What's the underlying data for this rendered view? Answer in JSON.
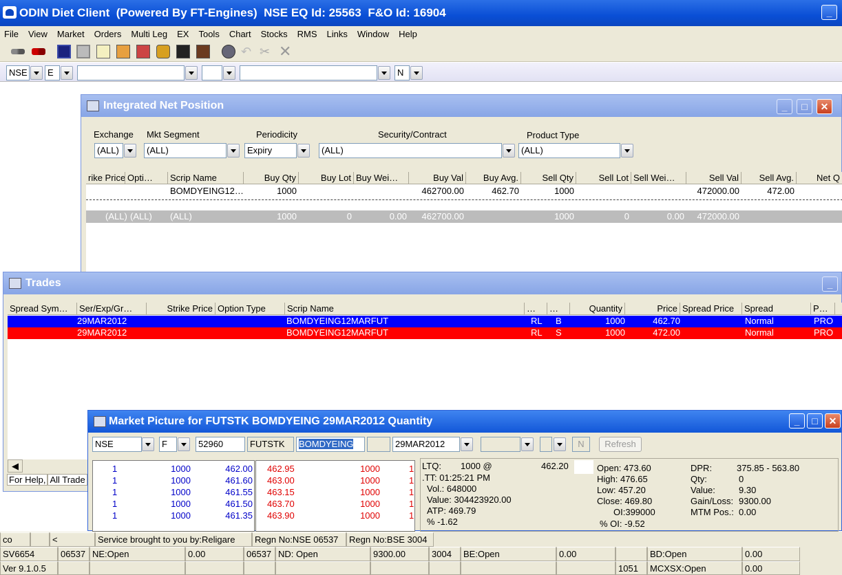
{
  "app": {
    "title": "ODIN Diet Client  (Powered By FT-Engines)  NSE EQ Id: 25563  F&O Id: 16904"
  },
  "menu": [
    "File",
    "View",
    "Market",
    "Orders",
    "Multi Leg",
    "EX",
    "Tools",
    "Chart",
    "Stocks",
    "RMS",
    "Links",
    "Window",
    "Help"
  ],
  "toolbar_icons": [
    "connect-icon",
    "disconnect-icon",
    "save-icon",
    "print-icon",
    "edit-icon",
    "watch-icon",
    "book-icon",
    "package-icon",
    "chart-icon",
    "binoculars-icon",
    "gear-icon",
    "undo-icon",
    "scissors-icon",
    "close-icon"
  ],
  "filterbar": {
    "exchange": "NSE",
    "segment": "E",
    "series": "N"
  },
  "net_position": {
    "title": "Integrated Net Position",
    "labels": {
      "exchange": "Exchange",
      "segment": "Mkt Segment",
      "periodicity": "Periodicity",
      "security": "Security/Contract",
      "product": "Product Type"
    },
    "values": {
      "exchange": "(ALL)",
      "segment": "(ALL)",
      "periodicity": "Expiry",
      "security": "(ALL)",
      "product": "(ALL)"
    },
    "columns": [
      "rike Price",
      "Opti…",
      "Scrip Name",
      "Buy Qty",
      "Buy Lot",
      "Buy Wei…",
      "Buy Val",
      "Buy Avg.",
      "Sell Qty",
      "Sell Lot",
      "Sell Wei…",
      "Sell Val",
      "Sell Avg.",
      "Net Q"
    ],
    "row": {
      "scrip": "BOMDYEING12…",
      "buy_qty": "1000",
      "buy_val": "462700.00",
      "buy_avg": "462.70",
      "sell_qty": "1000",
      "sell_val": "472000.00",
      "sell_avg": "472.00"
    },
    "total": {
      "strike": "(ALL)",
      "opt": "(ALL)",
      "scrip": "(ALL)",
      "buy_qty": "1000",
      "buy_lot": "0",
      "buy_wei": "0.00",
      "buy_val": "462700.00",
      "sell_qty": "1000",
      "sell_lot": "0",
      "sell_wei": "0.00",
      "sell_val": "472000.00"
    }
  },
  "trades": {
    "title": "Trades",
    "columns": [
      "Spread Sym…",
      "Ser/Exp/Gr…",
      "Strike Price",
      "Option Type",
      "Scrip Name",
      "…",
      "…",
      "Quantity",
      "Price",
      "Spread Price",
      "Spread",
      "P…"
    ],
    "rows": [
      {
        "exp": "29MAR2012",
        "scrip": "BOMDYEING12MARFUT",
        "d": "RL",
        "bs": "B",
        "qty": "1000",
        "price": "462.70",
        "spread": "Normal",
        "p": "PRO",
        "bg": "#0000ff"
      },
      {
        "exp": "29MAR2012",
        "scrip": "BOMDYEING12MARFUT",
        "d": "RL",
        "bs": "S",
        "qty": "1000",
        "price": "472.00",
        "spread": "Normal",
        "p": "PRO",
        "bg": "#ff0000"
      }
    ],
    "tabs": [
      "For Help,",
      "All Trade"
    ]
  },
  "market_picture": {
    "title": "Market Picture for FUTSTK BOMDYEING 29MAR2012  Quantity",
    "fields": {
      "exchange": "NSE",
      "segment": "F",
      "token": "52960",
      "instrument": "FUTSTK",
      "symbol": "BOMDYEING",
      "expiry": "29MAR2012",
      "n": "N",
      "refresh": "Refresh"
    },
    "bids": [
      {
        "orders": "1",
        "qty": "1000",
        "price": "462.00"
      },
      {
        "orders": "1",
        "qty": "1000",
        "price": "461.60"
      },
      {
        "orders": "1",
        "qty": "1000",
        "price": "461.55"
      },
      {
        "orders": "1",
        "qty": "1000",
        "price": "461.50"
      },
      {
        "orders": "1",
        "qty": "1000",
        "price": "461.35"
      }
    ],
    "asks": [
      {
        "price": "462.95",
        "qty": "1000",
        "orders": "1"
      },
      {
        "price": "463.00",
        "qty": "1000",
        "orders": "1"
      },
      {
        "price": "463.15",
        "qty": "1000",
        "orders": "1"
      },
      {
        "price": "463.70",
        "qty": "1000",
        "orders": "1"
      },
      {
        "price": "463.90",
        "qty": "1000",
        "orders": "1"
      }
    ],
    "stats1": {
      "ltq": "LTQ:",
      "ltq_val": "1000 @",
      "ltp": "462.20",
      "ltt": ".TT:  01:25:21 PM",
      "vol": "Vol.:   648000",
      "value": "Value: 304423920.00",
      "atp": "ATP:   469.79",
      "pct": "%      -1.62"
    },
    "stats2": {
      "open": "Open:  473.60",
      "high": "High:   476.65",
      "low": "Low:    457.20",
      "close": "Close:  469.80",
      "oi": "OI:399000",
      "pctoi": "% OI: -9.52"
    },
    "stats3": {
      "dpr_l": "DPR:",
      "dpr": "375.85 - 563.80",
      "qty_l": "Qty:",
      "qty": "0",
      "value_l": "Value:",
      "value": "9.30",
      "gl_l": "Gain/Loss:",
      "gl": "9300.00",
      "mtm_l": "MTM Pos.:",
      "mtm": "0.00"
    }
  },
  "status": {
    "r1": [
      "co",
      "",
      "<",
      "Service brought to you by:Religare",
      "Regn No:NSE 06537",
      "Regn No:BSE 3004"
    ],
    "r2": [
      "SV6654",
      "06537",
      "NE:Open",
      "0.00",
      "06537",
      "ND: Open",
      "9300.00",
      "3004",
      "BE:Open",
      "0.00",
      "",
      "BD:Open",
      "0.00"
    ],
    "r3": [
      "Ver 9.1.0.5",
      "",
      "",
      "",
      "",
      "",
      "",
      "",
      "",
      "",
      "1051",
      "MCXSX:Open",
      "0.00"
    ]
  }
}
